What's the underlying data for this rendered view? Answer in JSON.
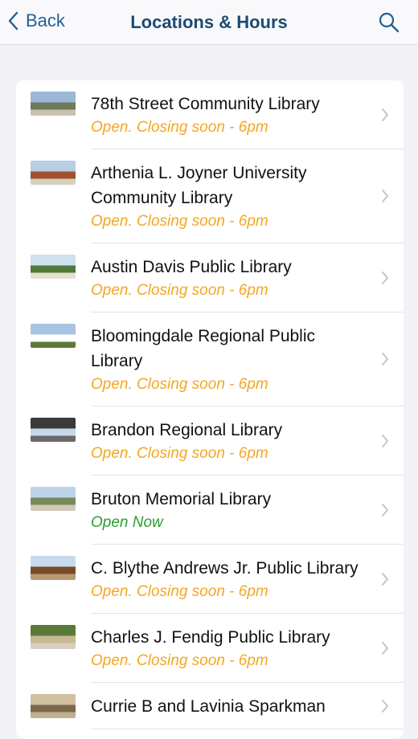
{
  "nav": {
    "back_label": "Back",
    "title": "Locations & Hours"
  },
  "colors": {
    "accent": "#1f5f99",
    "title": "#1c4a73",
    "closing": "#f5a623",
    "open": "#2e9d2e"
  },
  "libraries": [
    {
      "name": "78th Street Community Library",
      "status": "Open. Closing soon - 6pm",
      "state": "closing"
    },
    {
      "name": "Arthenia L. Joyner University Community Library",
      "status": "Open. Closing soon - 6pm",
      "state": "closing"
    },
    {
      "name": "Austin Davis Public Library",
      "status": "Open. Closing soon - 6pm",
      "state": "closing"
    },
    {
      "name": "Bloomingdale Regional Public Library",
      "status": "Open. Closing soon - 6pm",
      "state": "closing"
    },
    {
      "name": "Brandon Regional Library",
      "status": "Open. Closing soon - 6pm",
      "state": "closing"
    },
    {
      "name": "Bruton Memorial Library",
      "status": "Open Now",
      "state": "open"
    },
    {
      "name": "C. Blythe Andrews Jr. Public Library",
      "status": "Open. Closing soon - 6pm",
      "state": "closing"
    },
    {
      "name": "Charles J. Fendig Public Library",
      "status": "Open. Closing soon - 6pm",
      "state": "closing"
    },
    {
      "name": "Currie B and Lavinia Sparkman",
      "status": "",
      "state": "closing"
    }
  ]
}
